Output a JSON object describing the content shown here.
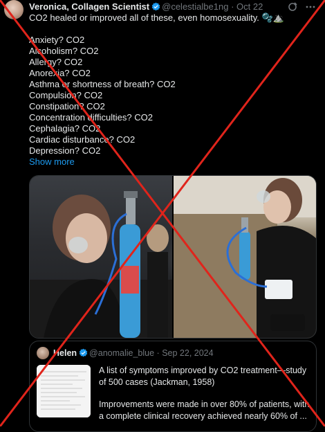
{
  "post": {
    "author_name": "Veronica, Collagen Scientist",
    "handle": "@celestialbe1ng",
    "dot": "·",
    "date": "Oct 22",
    "text_first": "CO2 healed or improved all of these, even homosexuality. 🫧⛰️",
    "list": [
      "Anxiety? CO2",
      "Alcoholism? CO2",
      "Allergy? CO2",
      "Anorexia? CO2",
      "Asthma or shortness of breath? CO2",
      "Compulsion? CO2",
      "Constipation? CO2",
      "Concentration difficulties? CO2",
      "Cephalagia? CO2",
      "Cardiac disturbance? CO2",
      "Depression? CO2"
    ],
    "show_more": "Show more"
  },
  "quote": {
    "author_name": "Helen",
    "handle": "@anomalie_blue",
    "dot": "·",
    "date": "Sep 22, 2024",
    "line1": "A list of symptoms improved by CO2 treatment—study",
    "line2": "of 500 cases (Jackman, 1958)",
    "line3": "Improvements were made in over 80% of patients, with",
    "line4": "a complete clinical recovery achieved nearly 60% of ..."
  },
  "colors": {
    "background": "#000000",
    "text": "#e7e9ea",
    "muted": "#71767b",
    "link": "#1d9bf0",
    "cross": "#e0241b"
  },
  "icons": [
    "verified-icon",
    "grok-icon",
    "more-icon",
    "cross-overlay"
  ]
}
